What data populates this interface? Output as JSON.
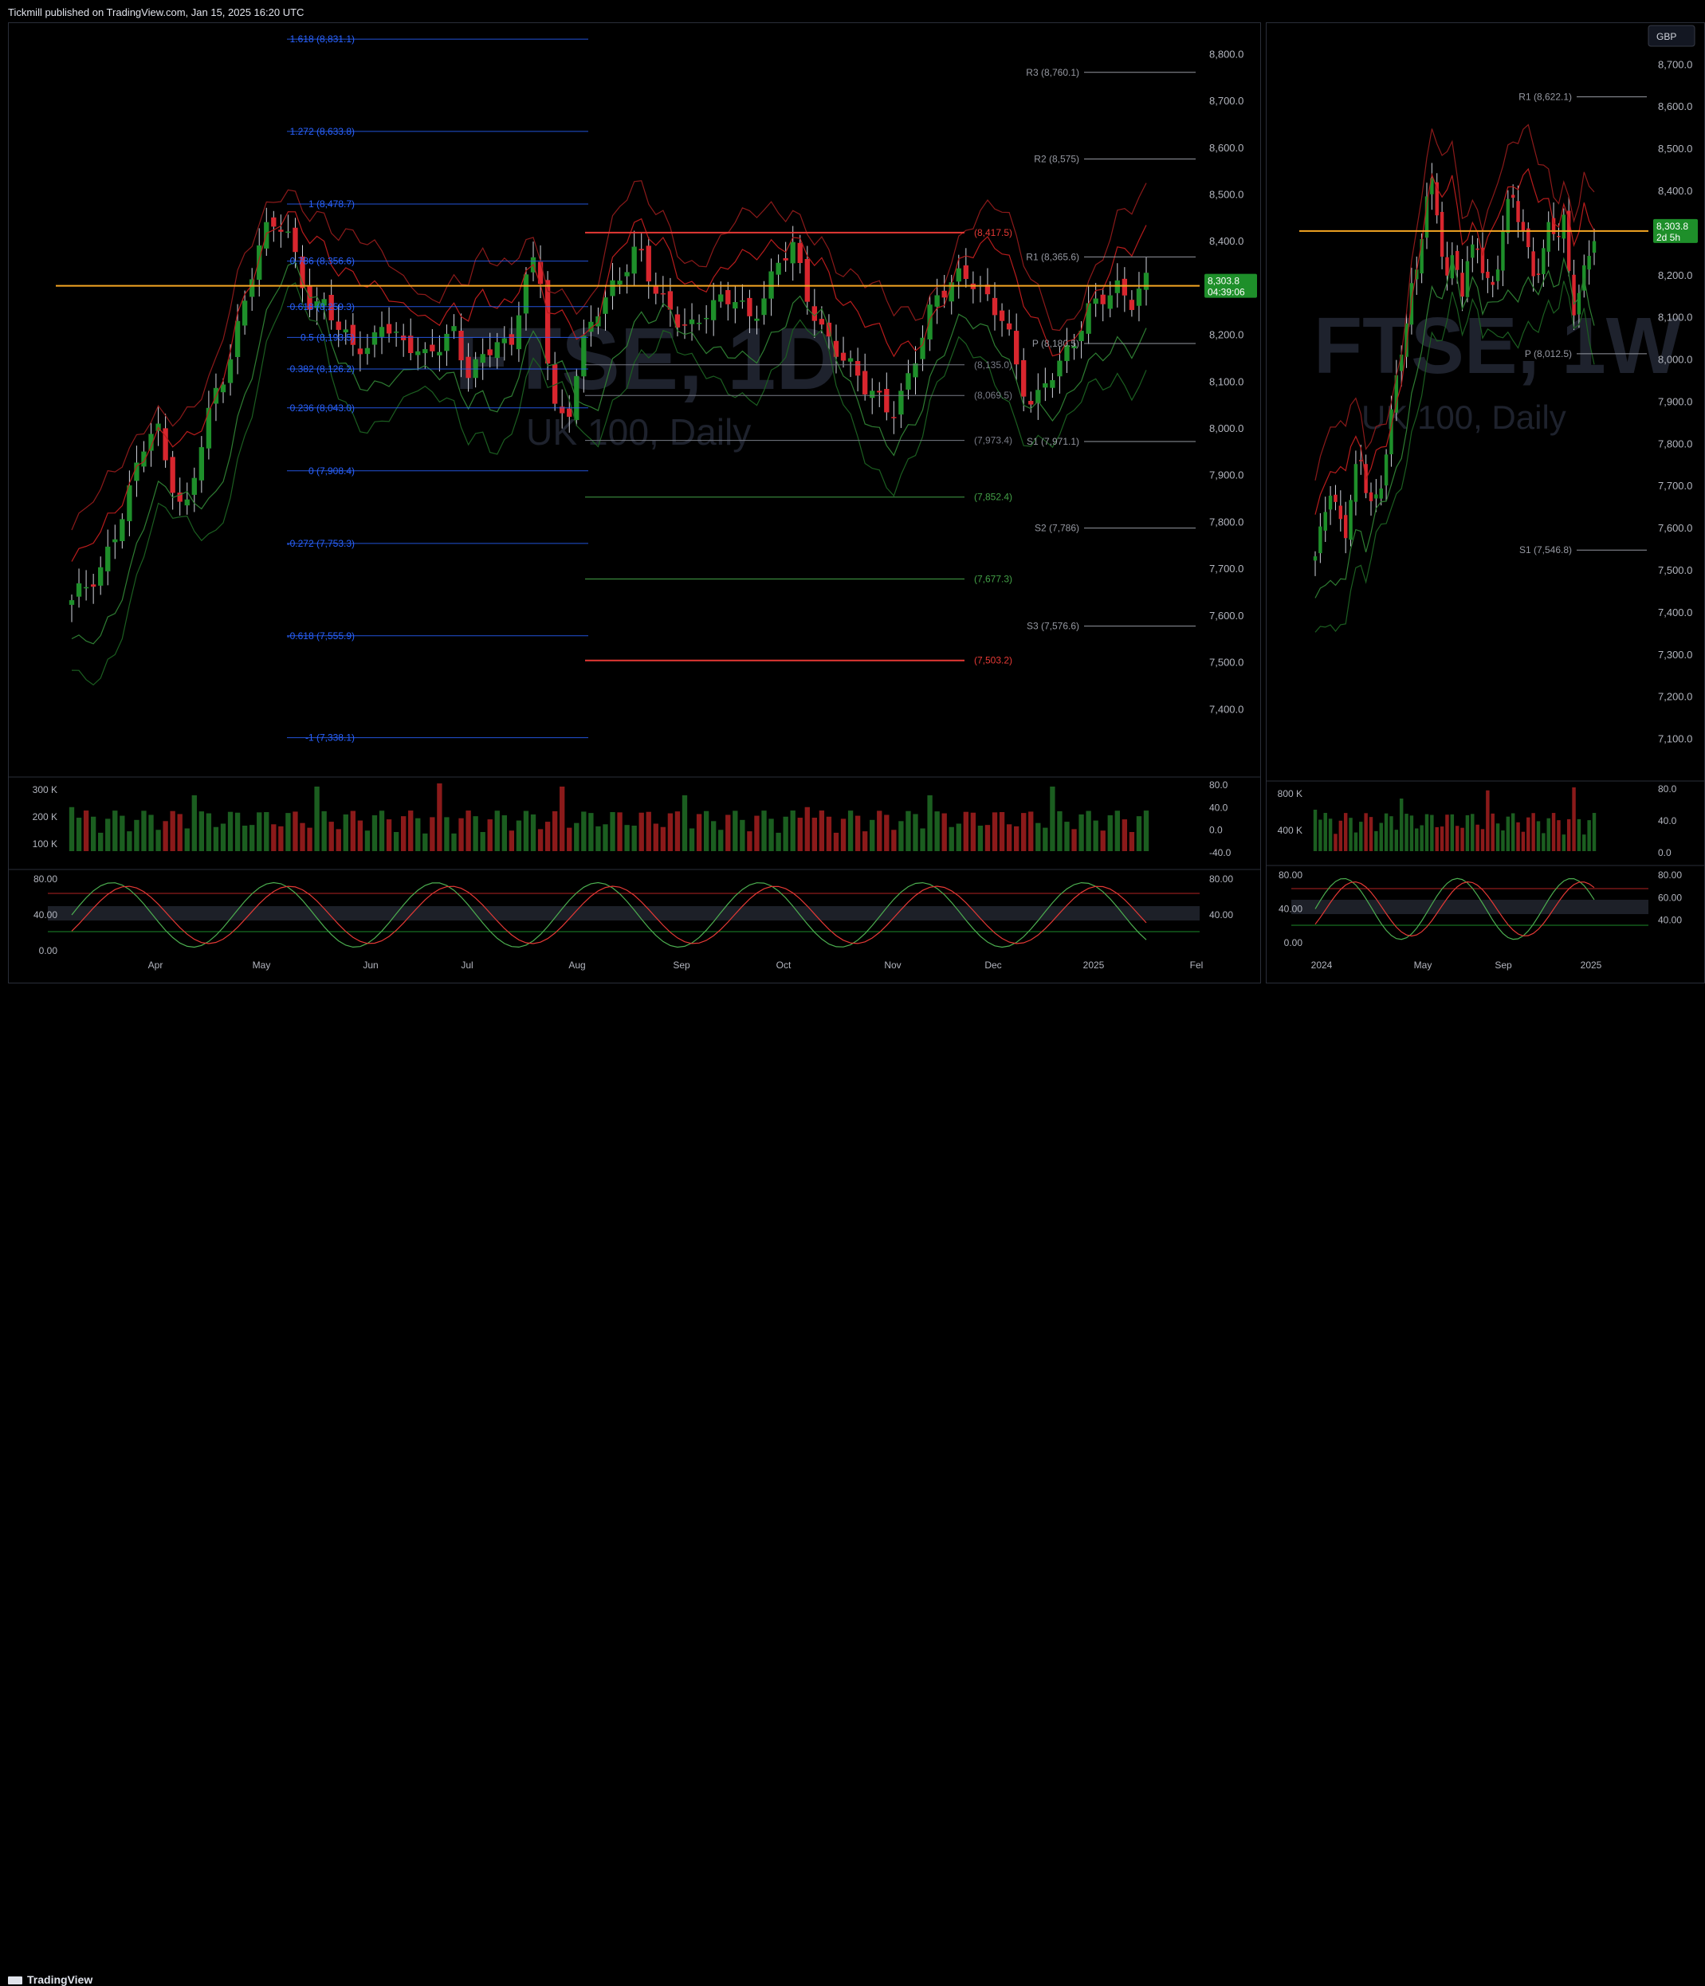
{
  "header": {
    "publisher": "Tickmill published on TradingView.com, Jan 15, 2025 16:20 UTC"
  },
  "footer": {
    "brand": "TradingView"
  },
  "colors": {
    "up": "#1e8f2a",
    "down": "#d8262e",
    "pivot": "#d1d4dc",
    "fib": "#2962ff",
    "accent_price": "#089981",
    "poc": "#f5a623",
    "bg": "#000000"
  },
  "left_chart": {
    "watermark_symbol": "FTSE, 1D",
    "watermark_name": "UK 100, Daily",
    "last_price": "8,303.8",
    "countdown": "04:39:06",
    "price_ticks": [
      "8,800.0",
      "8,700.0",
      "8,600.0",
      "8,500.0",
      "8,400.0",
      "8,300.0",
      "8,200.0",
      "8,100.0",
      "8,000.0",
      "7,900.0",
      "7,800.0",
      "7,700.0",
      "7,600.0",
      "7,500.0",
      "7,400.0"
    ],
    "time_ticks": [
      "Apr",
      "May",
      "Jun",
      "Jul",
      "Aug",
      "Sep",
      "Oct",
      "Nov",
      "Dec",
      "2025",
      "Fel"
    ],
    "fib_labels": [
      "1.618 (8,831.1)",
      "1.272 (8,633.8)",
      "1 (8,478.7)",
      "0.786 (8,356.6)",
      "0.618 (8,259.3)",
      "0.5 (8,193.5)",
      "0.382 (8,126.2)",
      "0.236 (8,043.0)",
      "0 (7,908.4)",
      "-0.272 (7,753.3)",
      "-0.618 (7,555.9)",
      "-1 (7,338.1)"
    ],
    "pivot_labels": [
      "R3 (8,760.1)",
      "R2 (8,575)",
      "R1 (8,365.6)",
      "P (8,180.5)",
      "S1 (7,971.1)",
      "S2 (7,786)",
      "S3 (7,576.6)"
    ],
    "extra_levels": [
      "(8,417.5)",
      "(8,135.0)",
      "(8,069.5)",
      "(7,973.4)",
      "(7,852.4)",
      "(7,677.3)",
      "(7,503.2)"
    ],
    "volume_ticks": [
      "300 K",
      "200 K",
      "100 K"
    ],
    "osc1_ticks": [
      "80.0",
      "40.0",
      "0.0",
      "-40.0"
    ],
    "osc2_ticks": [
      "80.00",
      "40.00",
      "0.00"
    ],
    "osc2_right_ticks": [
      "80.00",
      "40.00"
    ]
  },
  "right_chart": {
    "currency": "GBP",
    "watermark_symbol": "FTSE, 1W",
    "watermark_name": "UK 100, Daily",
    "last_price": "8,303.8",
    "countdown": "2d 5h",
    "price_ticks": [
      "8,700.0",
      "8,600.0",
      "8,500.0",
      "8,400.0",
      "8,300.0",
      "8,200.0",
      "8,100.0",
      "8,000.0",
      "7,900.0",
      "7,800.0",
      "7,700.0",
      "7,600.0",
      "7,500.0",
      "7,400.0",
      "7,300.0",
      "7,200.0",
      "7,100.0"
    ],
    "time_ticks": [
      "2024",
      "May",
      "Sep",
      "2025"
    ],
    "pivot_labels": [
      "R1 (8,622.1)",
      "P (8,012.5)",
      "S1 (7,546.8)"
    ],
    "volume_ticks": [
      "800 K",
      "400 K"
    ],
    "osc1_ticks": [
      "80.0",
      "40.0",
      "0.0"
    ],
    "osc2_left_ticks": [
      "80.00",
      "40.00",
      "0.00"
    ],
    "osc2_right_ticks": [
      "80.00",
      "60.00",
      "40.00"
    ]
  },
  "chart_data": [
    {
      "type": "candlestick",
      "title": "UK 100, Daily",
      "symbol": "FTSE, 1D",
      "ylim": [
        7300,
        8850
      ],
      "xlabel": "",
      "ylabel": "",
      "x_categories": [
        "Apr",
        "May",
        "Jun",
        "Jul",
        "Aug",
        "Sep",
        "Oct",
        "Nov",
        "Dec",
        "2025",
        "Fel"
      ],
      "last_close": 8303.8,
      "approx_closes": [
        7620,
        7660,
        7700,
        7780,
        7850,
        7950,
        8000,
        7900,
        7820,
        7950,
        8050,
        8120,
        8250,
        8380,
        8440,
        8420,
        8340,
        8250,
        8290,
        8200,
        8170,
        8150,
        8240,
        8200,
        8180,
        8140,
        8170,
        8210,
        8130,
        8150,
        8180,
        8150,
        8320,
        8380,
        8050,
        8000,
        8150,
        8250,
        8300,
        8340,
        8380,
        8300,
        8260,
        8240,
        8220,
        8250,
        8260,
        8280,
        8240,
        8290,
        8350,
        8380,
        8280,
        8220,
        8180,
        8130,
        8080,
        8060,
        8040,
        8100,
        8180,
        8260,
        8300,
        8340,
        8320,
        8260,
        8220,
        8100,
        8050,
        8120,
        8140,
        8180,
        8250,
        8290,
        8310,
        8270,
        8304
      ],
      "fibonacci": [
        [
          1.618,
          8831.1
        ],
        [
          1.272,
          8633.8
        ],
        [
          1,
          8478.7
        ],
        [
          0.786,
          8356.6
        ],
        [
          0.618,
          8259.3
        ],
        [
          0.5,
          8193.5
        ],
        [
          0.382,
          8126.2
        ],
        [
          0.236,
          8043.0
        ],
        [
          0,
          7908.4
        ],
        [
          -0.272,
          7753.3
        ],
        [
          -0.618,
          7555.9
        ],
        [
          -1,
          7338.1
        ]
      ],
      "pivots": {
        "R3": 8760.1,
        "R2": 8575,
        "R1": 8365.6,
        "P": 8180.5,
        "S1": 7971.1,
        "S2": 7786,
        "S3": 7576.6
      },
      "levels": [
        8417.5,
        8135.0,
        8069.5,
        7973.4,
        7852.4,
        7677.3,
        7503.2
      ]
    },
    {
      "type": "candlestick",
      "title": "UK 100, Daily",
      "symbol": "FTSE, 1W",
      "ylim": [
        7050,
        8780
      ],
      "x_categories": [
        "2024",
        "May",
        "Sep",
        "2025"
      ],
      "last_close": 8303.8,
      "approx_closes": [
        7520,
        7600,
        7700,
        7650,
        7580,
        7700,
        7760,
        7680,
        7640,
        7700,
        7850,
        7950,
        8050,
        8150,
        8200,
        8380,
        8420,
        8300,
        8200,
        8250,
        8150,
        8230,
        8280,
        8200,
        8170,
        8250,
        8350,
        8380,
        8300,
        8250,
        8200,
        8250,
        8350,
        8280,
        8320,
        8100,
        8150,
        8250,
        8304
      ],
      "pivots": {
        "R1": 8622.1,
        "P": 8012.5,
        "S1": 7546.8
      }
    }
  ]
}
